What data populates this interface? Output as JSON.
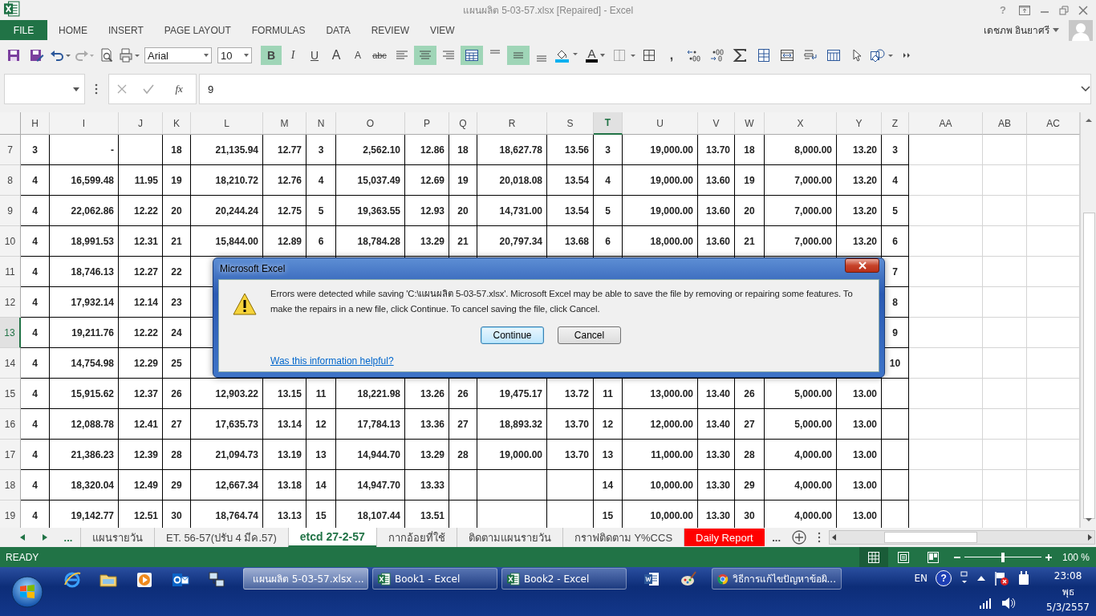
{
  "window": {
    "title": "แผนผลิต 5-03-57.xlsx [Repaired] - Excel",
    "help": "?"
  },
  "ribbon": {
    "file_tab": "FILE",
    "tabs": [
      "HOME",
      "INSERT",
      "PAGE LAYOUT",
      "FORMULAS",
      "DATA",
      "REVIEW",
      "VIEW"
    ],
    "user": "เดชภพ อินยาศรี"
  },
  "toolbar": {
    "font_name": "Arial",
    "font_size": "10",
    "text_buttons": [
      {
        "label": "B",
        "on": true
      },
      {
        "label": "I",
        "on": false
      },
      {
        "label": "U",
        "on": false
      },
      {
        "label": "A",
        "on": false
      },
      {
        "label": "A",
        "on": false
      },
      {
        "label": "abc",
        "on": false
      }
    ],
    "align_buttons": [
      {
        "on": false
      },
      {
        "on": true
      },
      {
        "on": false
      },
      {
        "on": true
      },
      {
        "on": false
      },
      {
        "on": true
      },
      {
        "on": false
      }
    ],
    "font_color": "A",
    "comma": ","
  },
  "formula_bar": {
    "fx": "fx",
    "value": "9"
  },
  "sheet": {
    "columns": [
      {
        "label": "H",
        "selected": false
      },
      {
        "label": "I",
        "selected": false
      },
      {
        "label": "J",
        "selected": false
      },
      {
        "label": "K",
        "selected": false
      },
      {
        "label": "L",
        "selected": false
      },
      {
        "label": "M",
        "selected": false
      },
      {
        "label": "N",
        "selected": false
      },
      {
        "label": "O",
        "selected": false
      },
      {
        "label": "P",
        "selected": false
      },
      {
        "label": "Q",
        "selected": false
      },
      {
        "label": "R",
        "selected": false
      },
      {
        "label": "S",
        "selected": false
      },
      {
        "label": "T",
        "selected": true
      },
      {
        "label": "U",
        "selected": false
      },
      {
        "label": "V",
        "selected": false
      },
      {
        "label": "W",
        "selected": false
      },
      {
        "label": "X",
        "selected": false
      },
      {
        "label": "Y",
        "selected": false
      },
      {
        "label": "Z",
        "selected": false
      },
      {
        "label": "AA",
        "selected": false
      },
      {
        "label": "AB",
        "selected": false
      },
      {
        "label": "AC",
        "selected": false
      }
    ],
    "rows": [
      {
        "label": "7",
        "selected": false,
        "cells": [
          "3",
          "-",
          null,
          "18",
          "21,135.94",
          "12.77",
          "3",
          "2,562.10",
          "12.86",
          "18",
          "18,627.78",
          "13.56",
          "3",
          "19,000.00",
          "13.70",
          "18",
          "8,000.00",
          "13.20",
          "3",
          null,
          null,
          null
        ]
      },
      {
        "label": "8",
        "selected": false,
        "cells": [
          "4",
          "16,599.48",
          "11.95",
          "19",
          "18,210.72",
          "12.76",
          "4",
          "15,037.49",
          "12.69",
          "19",
          "20,018.08",
          "13.54",
          "4",
          "19,000.00",
          "13.60",
          "19",
          "7,000.00",
          "13.20",
          "4",
          null,
          null,
          null
        ]
      },
      {
        "label": "9",
        "selected": false,
        "cells": [
          "4",
          "22,062.86",
          "12.22",
          "20",
          "20,244.24",
          "12.75",
          "5",
          "19,363.55",
          "12.93",
          "20",
          "14,731.00",
          "13.54",
          "5",
          "19,000.00",
          "13.60",
          "20",
          "7,000.00",
          "13.20",
          "5",
          null,
          null,
          null
        ]
      },
      {
        "label": "10",
        "selected": false,
        "cells": [
          "4",
          "18,991.53",
          "12.31",
          "21",
          "15,844.00",
          "12.89",
          "6",
          "18,784.28",
          "13.29",
          "21",
          "20,797.34",
          "13.68",
          "6",
          "18,000.00",
          "13.60",
          "21",
          "7,000.00",
          "13.20",
          "6",
          null,
          null,
          null
        ]
      },
      {
        "label": "11",
        "selected": false,
        "cells": [
          "4",
          "18,746.13",
          "12.27",
          "22",
          null,
          null,
          null,
          null,
          null,
          null,
          null,
          null,
          null,
          null,
          null,
          null,
          null,
          null,
          "7",
          null,
          null,
          null
        ]
      },
      {
        "label": "12",
        "selected": false,
        "cells": [
          "4",
          "17,932.14",
          "12.14",
          "23",
          null,
          null,
          null,
          null,
          null,
          null,
          null,
          null,
          null,
          null,
          null,
          null,
          null,
          null,
          "8",
          null,
          null,
          null
        ]
      },
      {
        "label": "13",
        "selected": true,
        "cells": [
          "4",
          "19,211.76",
          "12.22",
          "24",
          null,
          null,
          null,
          null,
          null,
          null,
          null,
          null,
          null,
          null,
          null,
          null,
          null,
          null,
          "9",
          null,
          null,
          null
        ]
      },
      {
        "label": "14",
        "selected": false,
        "cells": [
          "4",
          "14,754.98",
          "12.29",
          "25",
          null,
          null,
          null,
          null,
          null,
          null,
          null,
          null,
          null,
          null,
          null,
          null,
          null,
          null,
          "10",
          null,
          null,
          null
        ]
      },
      {
        "label": "15",
        "selected": false,
        "cells": [
          "4",
          "15,915.62",
          "12.37",
          "26",
          "12,903.22",
          "13.15",
          "11",
          "18,221.98",
          "13.26",
          "26",
          "19,475.17",
          "13.72",
          "11",
          "13,000.00",
          "13.40",
          "26",
          "5,000.00",
          "13.00",
          null,
          null,
          null,
          null
        ]
      },
      {
        "label": "16",
        "selected": false,
        "cells": [
          "4",
          "12,088.78",
          "12.41",
          "27",
          "17,635.73",
          "13.14",
          "12",
          "17,784.13",
          "13.36",
          "27",
          "18,893.32",
          "13.70",
          "12",
          "12,000.00",
          "13.40",
          "27",
          "5,000.00",
          "13.00",
          null,
          null,
          null,
          null
        ]
      },
      {
        "label": "17",
        "selected": false,
        "cells": [
          "4",
          "21,386.23",
          "12.39",
          "28",
          "21,094.73",
          "13.19",
          "13",
          "14,944.70",
          "13.29",
          "28",
          "19,000.00",
          "13.70",
          "13",
          "11,000.00",
          "13.30",
          "28",
          "4,000.00",
          "13.00",
          null,
          null,
          null,
          null
        ]
      },
      {
        "label": "18",
        "selected": false,
        "cells": [
          "4",
          "18,320.04",
          "12.49",
          "29",
          "12,667.34",
          "13.18",
          "14",
          "14,947.70",
          "13.33",
          null,
          null,
          null,
          "14",
          "10,000.00",
          "13.30",
          "29",
          "4,000.00",
          "13.00",
          null,
          null,
          null,
          null
        ]
      },
      {
        "label": "19",
        "selected": false,
        "cells": [
          "4",
          "19,142.77",
          "12.51",
          "30",
          "18,764.74",
          "13.13",
          "15",
          "18,107.44",
          "13.51",
          null,
          null,
          null,
          "15",
          "10,000.00",
          "13.30",
          "30",
          "4,000.00",
          "13.00",
          null,
          null,
          null,
          null
        ]
      }
    ]
  },
  "dialog": {
    "title": "Microsoft Excel",
    "message": "Errors were detected while saving 'C:\\แผนผลิต 5-03-57.xlsx'. Microsoft Excel may be able to save the file by removing or repairing some features. To make the repairs in a new file, click Continue. To cancel saving the file, click Cancel.",
    "buttons": [
      {
        "label": "Continue",
        "selected": true
      },
      {
        "label": "Cancel",
        "selected": false
      }
    ],
    "link": "Was this information helpful?"
  },
  "sheet_tabs": {
    "more_before": "...",
    "tabs": [
      {
        "label": "แผนรายวัน",
        "selected": false
      },
      {
        "label": "ET. 56-57(ปรับ 4 มีค.57)",
        "selected": false
      },
      {
        "label": "etcd 27-2-57",
        "selected": true
      },
      {
        "label": "กากอ้อยที่ใช้",
        "selected": false
      },
      {
        "label": "ติดตามแผนรายวัน",
        "selected": false
      },
      {
        "label": "กราฟติดตาม Y%CCS",
        "selected": false
      },
      {
        "label": "Daily Report",
        "selected": false,
        "color": "#ff0000"
      }
    ],
    "more_after": "..."
  },
  "status_bar": {
    "status": "READY",
    "views": [
      {
        "selected": true
      },
      {
        "selected": false
      },
      {
        "selected": false
      }
    ],
    "zoom": {
      "level": 0.5,
      "reading": "100 %"
    }
  },
  "taskbar": {
    "tasks": [
      {
        "label": "แผนผลิต 5-03-57.xlsx ...",
        "selected": true
      },
      {
        "label": "Book1 - Excel",
        "selected": false
      },
      {
        "label": "Book2 - Excel",
        "selected": false
      }
    ],
    "browser_task": {
      "label": "วิธีการแก้ไขปัญหาข้อผิ...",
      "selected": false
    },
    "language": "EN",
    "help": "?",
    "time": "23:08",
    "day": "พุธ",
    "date": "5/3/2557"
  }
}
